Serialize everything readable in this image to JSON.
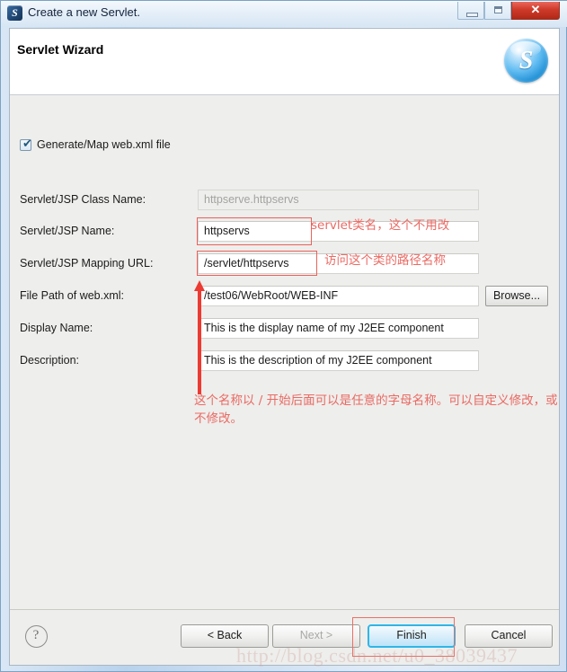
{
  "window": {
    "title": "Create a new Servlet.",
    "icon": "servlet-app-icon",
    "icon_glyph": "S",
    "controls": {
      "minimize": "minimize-icon",
      "maximize": "maximize-icon",
      "close_glyph": "✕"
    }
  },
  "header": {
    "title": "Servlet Wizard",
    "logo_glyph": "S",
    "logo_name": "servlet-wizard-logo"
  },
  "form": {
    "checkbox": {
      "label": "Generate/Map web.xml file",
      "checked": true,
      "check_glyph": "✔"
    },
    "fields": [
      {
        "label": "Servlet/JSP Class Name:",
        "value": "httpserve.httpservs",
        "disabled": true
      },
      {
        "label": "Servlet/JSP Name:",
        "value": "httpservs",
        "disabled": false
      },
      {
        "label": "Servlet/JSP Mapping URL:",
        "value": "/servlet/httpservs",
        "disabled": false
      },
      {
        "label": "File Path of web.xml:",
        "value": "/test06/WebRoot/WEB-INF",
        "disabled": false
      },
      {
        "label": "Display Name:",
        "value": "This is the display name of my J2EE component",
        "disabled": false
      },
      {
        "label": "Description:",
        "value": "This is the description of my J2EE component",
        "disabled": false
      }
    ],
    "browse_label": "Browse..."
  },
  "annotations": {
    "color": "#ea6a63",
    "arrow_color": "#ec3b32",
    "note_class_name": "servlet类名，这个不用改",
    "note_mapping_url": "访问这个类的路径名称",
    "note_path_rule": "这个名称以 / 开始后面可以是任意的字母名称。可以自定义修改，或不修改。"
  },
  "buttons": {
    "help_glyph": "?",
    "back": "< Back",
    "next": "Next >",
    "finish": "Finish",
    "cancel": "Cancel"
  },
  "watermark": "http://blog.csdn.net/u0_38039437"
}
